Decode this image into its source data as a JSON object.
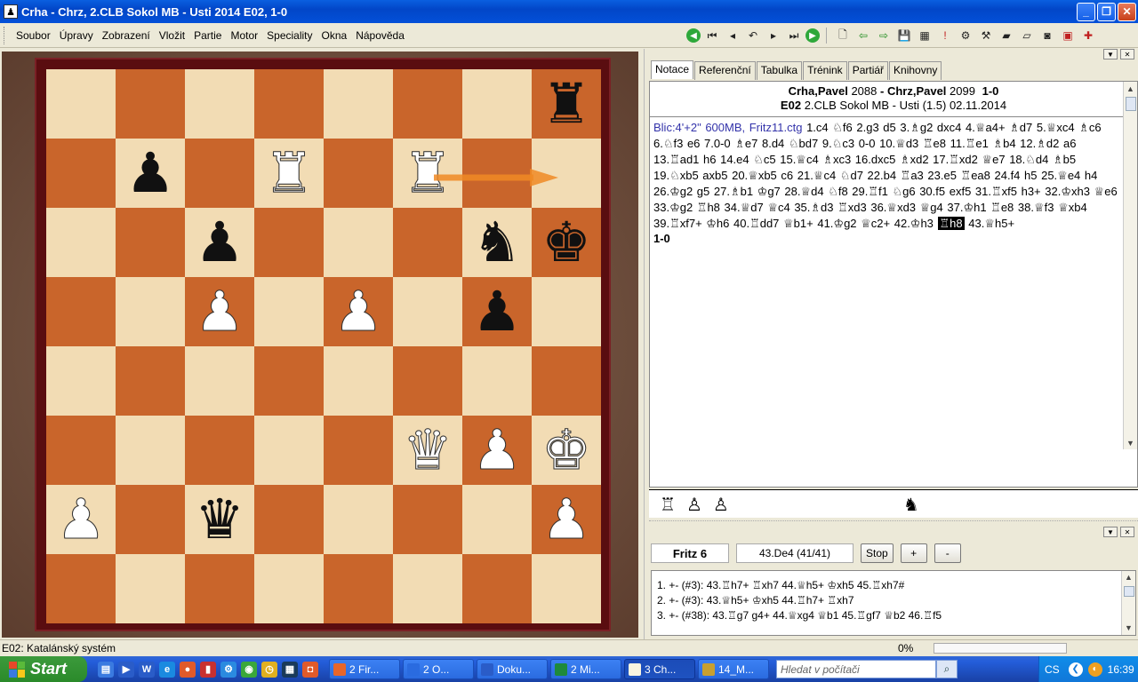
{
  "window": {
    "title": "Crha - Chrz, 2.CLB Sokol MB - Usti 2014  E02, 1-0",
    "app_icon": "chessboard-icon"
  },
  "menu": [
    "Soubor",
    "Úpravy",
    "Zobrazení",
    "Vložit",
    "Partie",
    "Motor",
    "Speciality",
    "Okna",
    "Nápověda"
  ],
  "toolbar_icons": [
    "first-move-green-icon",
    "start-icon",
    "back-icon",
    "takeback-icon",
    "forward-icon",
    "end-icon",
    "forward-green-icon",
    "new-doc-icon",
    "left-arrow-icon",
    "right-arrow-icon",
    "save-icon",
    "save-as-icon",
    "tools-icon",
    "engine-icon",
    "options-icon",
    "eraser-icon",
    "eraser2-icon",
    "camera-icon",
    "print-icon",
    "plus-icon"
  ],
  "board": {
    "squares": [
      [
        "",
        "",
        "",
        "",
        "",
        "",
        "",
        "bR"
      ],
      [
        "",
        "bP",
        "",
        "wR",
        "",
        "wR",
        "",
        ""
      ],
      [
        "",
        "",
        "bP",
        "",
        "",
        "",
        "bN",
        "bK"
      ],
      [
        "",
        "",
        "wP",
        "",
        "wP",
        "",
        "bP",
        ""
      ],
      [
        "",
        "",
        "",
        "",
        "",
        "",
        "",
        ""
      ],
      [
        "",
        "",
        "",
        "",
        "",
        "wQ",
        "wP",
        "wK"
      ],
      [
        "wP",
        "",
        "bQ",
        "",
        "",
        "",
        "",
        "wP"
      ],
      [
        "",
        "",
        "",
        "",
        "",
        "",
        "",
        ""
      ]
    ],
    "arrow_color": "#f08a24",
    "light_color": "#f2dcb4",
    "dark_color": "#c9652b"
  },
  "tabs": [
    "Notace",
    "Referenční",
    "Tabulka",
    "Trénink",
    "Partiář",
    "Knihovny"
  ],
  "game": {
    "white": "Crha,Pavel",
    "white_elo": "2088",
    "black": "Chrz,Pavel",
    "black_elo": "2099",
    "result": "1-0",
    "eco": "E02",
    "event": "2.CLB Sokol MB - Usti (1.5) 02.11.2014"
  },
  "notation": {
    "source": "Blic:4'+2\"  600MB, Fritz11.ctg",
    "moves_before": "1.c4 ♘f6 2.g3 d5 3.♗g2 dxc4 4.♕a4+ ♗d7 5.♕xc4 ♗c6 6.♘f3 e6 7.0-0 ♗e7 8.d4 ♘bd7 9.♘c3 0-0 10.♕d3 ♖e8 11.♖e1 ♗b4 12.♗d2 a6 13.♖ad1 h6 14.e4 ♘c5 15.♕c4 ♗xc3 16.dxc5 ♗xd2 17.♖xd2 ♕e7 18.♘d4 ♗b5 19.♘xb5 axb5 20.♕xb5 c6 21.♕c4 ♘d7 22.b4 ♖a3 23.e5 ♖ea8 24.f4 h5 25.♕e4 h4 26.♔g2 g5 27.♗b1 ♔g7 28.♕d4 ♘f8 29.♖f1 ♘g6 30.f5 exf5 31.♖xf5 h3+ 32.♔xh3 ♕e6 33.♔g2 ♖h8 34.♕d7 ♕c4 35.♗d3 ♖xd3 36.♕xd3 ♕g4 37.♔h1 ♖e8 38.♕f3 ♕xb4 39.♖xf7+ ♔h6 40.♖dd7 ♕b1+ 41.♔g2 ♕c2+ 42.♔h3 ",
    "current_move": "♖h8",
    "moves_after": " 43.♕h5+",
    "result": "1-0"
  },
  "captured": {
    "white": [
      "♖",
      "♙",
      "♙"
    ],
    "black": [
      "♞"
    ]
  },
  "engine": {
    "name": "Fritz 6",
    "current": "43.De4 (41/41)",
    "stop_label": "Stop",
    "plus_label": "+",
    "minus_label": "-",
    "lines": [
      "1. +-  (#3): 43.♖h7+ ♖xh7 44.♕h5+ ♔xh5 45.♖xh7#",
      "2. +-  (#3): 43.♕h5+ ♔xh5 44.♖h7+ ♖xh7",
      "3. +-  (#38): 43.♖g7 g4+ 44.♕xg4 ♕b1 45.♖gf7 ♕b2 46.♖f5"
    ]
  },
  "status": {
    "opening": "E02: Katalánský systém",
    "percent": "0%"
  },
  "taskbar": {
    "start_label": "Start",
    "tasks": [
      {
        "label": "2 Fir...",
        "color": "#e8662a"
      },
      {
        "label": "2 O...",
        "color": "#2a6be0"
      },
      {
        "label": "Doku...",
        "color": "#2a5cc8"
      },
      {
        "label": "2 Mi...",
        "color": "#1e8a3c"
      },
      {
        "label": "3 Ch...",
        "color": "#f8f4e0"
      },
      {
        "label": "14_M...",
        "color": "#c8a030"
      }
    ],
    "search_placeholder": "Hledat v počítači",
    "lang": "CS",
    "time": "16:39"
  }
}
